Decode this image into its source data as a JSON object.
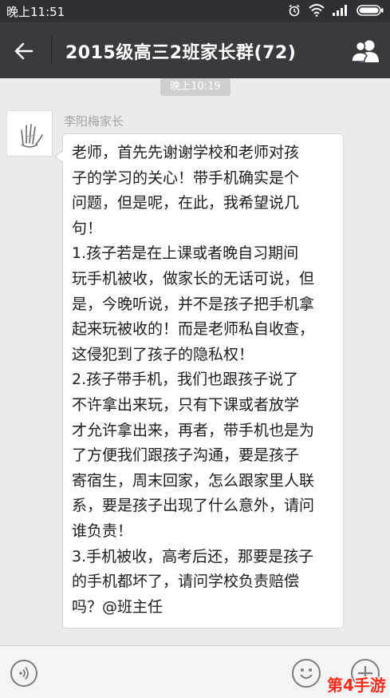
{
  "status_bar": {
    "time": "晚上11:51",
    "icons": [
      "alarm-icon",
      "wifi-icon",
      "signal-icon",
      "battery-icon"
    ]
  },
  "header": {
    "back_icon": "arrow-left-icon",
    "title": "2015级高三2班家长群(72)",
    "members_icon": "group-members-icon"
  },
  "chat": {
    "timestamp": "晚上10:19",
    "message": {
      "sender": "李阳梅家长",
      "avatar_icon": "hand-drawing-avatar",
      "lines": [
        "老师，首先先谢谢学校和老师对孩",
        "子的学习的关心！带手机确实是个",
        "问题，但是呢，在此，我希望说几",
        "句！",
        "1.孩子若是在上课或者晚自习期间",
        "玩手机被收，做家长的无话可说，但",
        "是，今晚听说，并不是孩子把手机拿",
        "起来玩被收的！而是老师私自收查，",
        "这侵犯到了孩子的隐私权！",
        "2.孩子带手机，我们也跟孩子说了",
        "不许拿出来玩，只有下课或者放学",
        "才允许拿出来，再者，带手机也是为",
        "了方便我们跟孩子沟通，要是孩子",
        "寄宿生，周末回家，怎么跟家里人联",
        "系，要是孩子出现了什么意外，请问",
        "谁负责！",
        "3.手机被收，高考后还，那要是孩子",
        "的手机都坏了，请问学校负责赔偿",
        "吗？@班主任"
      ]
    }
  },
  "input_bar": {
    "voice_icon": "voice-icon",
    "emoji_icon": "smiley-icon",
    "more_icon": "plus-icon"
  },
  "watermark": "第4手游"
}
